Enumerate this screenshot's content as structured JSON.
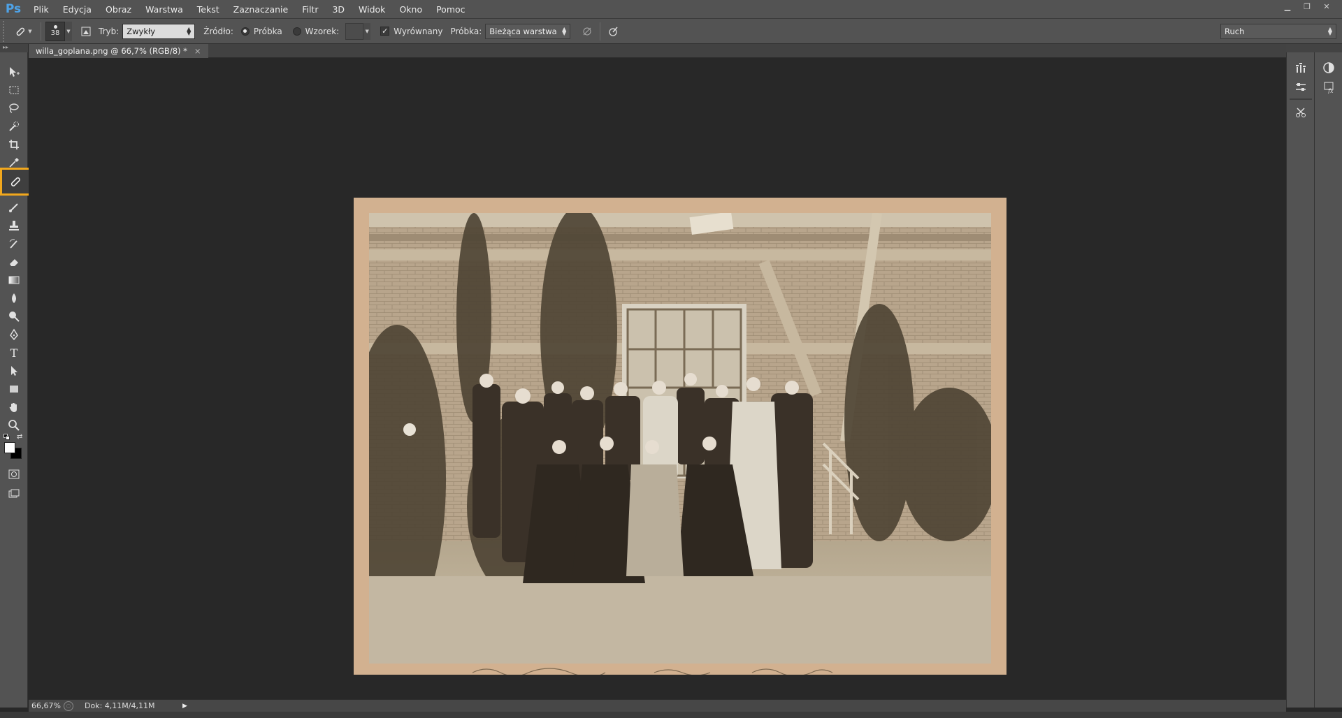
{
  "app": {
    "logo": "Ps",
    "menu": [
      "Plik",
      "Edycja",
      "Obraz",
      "Warstwa",
      "Tekst",
      "Zaznaczanie",
      "Filtr",
      "3D",
      "Widok",
      "Okno",
      "Pomoc"
    ],
    "window_controls": [
      "minimize-icon",
      "restore-icon",
      "close-icon"
    ]
  },
  "options": {
    "brush_size": "38",
    "mode_label": "Tryb:",
    "mode_value": "Zwykły",
    "source_label": "Źródło:",
    "source_sample_label": "Próbka",
    "source_pattern_label": "Wzorek:",
    "source_selected": "Próbka",
    "aligned_label": "Wyrównany",
    "aligned_checked": true,
    "sample_label": "Próbka:",
    "sample_value": "Bieżąca warstwa",
    "workspace_value": "Ruch"
  },
  "document": {
    "tab_title": "willa_goplana.png @ 66,7% (RGB/8) *",
    "close_symbol": "×"
  },
  "tools": [
    "move-tool",
    "marquee-tool",
    "lasso-tool",
    "quick-selection-tool",
    "crop-tool",
    "eyedropper-tool",
    "healing-brush-tool",
    "brush-tool",
    "clone-stamp-tool",
    "history-brush-tool",
    "eraser-tool",
    "gradient-tool",
    "blur-tool",
    "dodge-tool",
    "pen-tool",
    "type-tool",
    "path-selection-tool",
    "rectangle-tool",
    "hand-tool",
    "zoom-tool"
  ],
  "active_tool": "healing-brush-tool",
  "colors": {
    "foreground": "#ffffff",
    "background": "#000000",
    "active_highlight": "#f2a81d",
    "logo_blue": "#4ea3e8"
  },
  "status": {
    "zoom": "66,67%",
    "doc_info": "Dok: 4,11M/4,11M"
  }
}
